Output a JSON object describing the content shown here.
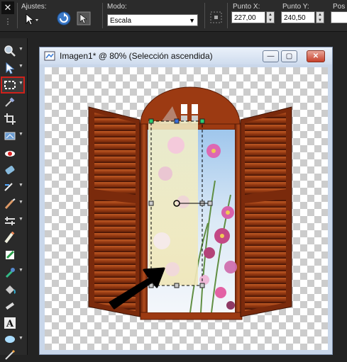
{
  "toolbar": {
    "close_symbol": "✕",
    "settings_label": "Ajustes:",
    "mode_label": "Modo:",
    "mode_value": "Escala",
    "point_x_label": "Punto X:",
    "point_x_value": "227,00",
    "point_y_label": "Punto Y:",
    "point_y_value": "240,50",
    "pos_label": "Pos"
  },
  "tools": [
    {
      "name": "zoom-tool",
      "icon": "zoom-icon",
      "active": false
    },
    {
      "name": "pick-tool",
      "icon": "pointer-arrow-icon",
      "active": false
    },
    {
      "name": "selection-tool",
      "icon": "selection-marquee-icon",
      "active": true
    },
    {
      "name": "dropper-tool",
      "icon": "eyedropper-icon",
      "active": false
    },
    {
      "name": "crop-tool",
      "icon": "crop-icon",
      "active": false
    },
    {
      "name": "straighten-tool",
      "icon": "straighten-icon",
      "active": false
    },
    {
      "name": "red-eye-tool",
      "icon": "red-eye-icon",
      "active": false
    },
    {
      "name": "makeover-tool",
      "icon": "makeover-icon",
      "active": false
    },
    {
      "name": "clone-brush-tool",
      "icon": "clone-brush-icon",
      "active": false
    },
    {
      "name": "scratch-remover-tool",
      "icon": "scratch-remover-icon",
      "active": false
    },
    {
      "name": "dodge-tool",
      "icon": "dodge-icon",
      "active": false
    },
    {
      "name": "eraser-tool",
      "icon": "eraser-icon",
      "active": false
    },
    {
      "name": "paint-brush-tool",
      "icon": "paint-brush-icon",
      "active": false
    },
    {
      "name": "color-replacer-tool",
      "icon": "color-replacer-icon",
      "active": false
    },
    {
      "name": "flood-fill-tool",
      "icon": "flood-fill-icon",
      "active": false
    },
    {
      "name": "picture-tube-tool",
      "icon": "picture-tube-icon",
      "active": false
    },
    {
      "name": "text-tool",
      "icon": "text-icon",
      "active": false
    },
    {
      "name": "preset-shape-tool",
      "icon": "preset-shape-icon",
      "active": false
    },
    {
      "name": "pen-tool",
      "icon": "pen-icon",
      "active": false
    }
  ],
  "document": {
    "title": "Imagen1* @  80% (Selección ascendida)",
    "minimize_symbol": "—",
    "maximize_symbol": "▢",
    "close_symbol": "✕"
  },
  "colors": {
    "wood_dark": "#6b230b",
    "wood_mid": "#9c3a12",
    "wood_light": "#c05a24",
    "selection_handle": "#2ecc71",
    "accent_red": "#d0211b",
    "arrow": "#000000"
  }
}
